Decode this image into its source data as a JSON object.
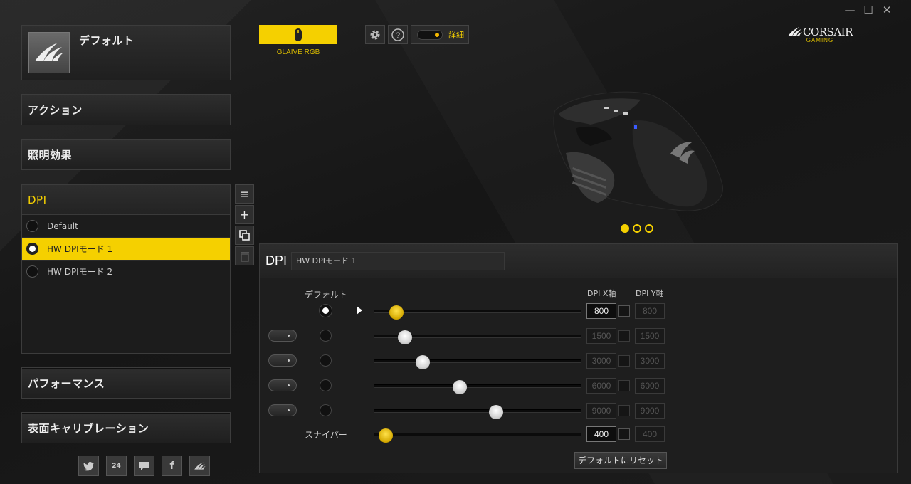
{
  "window": {
    "minimize": "—",
    "maximize": "☐",
    "close": "✕"
  },
  "sidebar": {
    "profile_name": "デフォルト",
    "sections": {
      "actions": "アクション",
      "lighting": "照明効果",
      "dpi": "DPI",
      "performance": "パフォーマンス",
      "calibration": "表面キャリブレーション"
    },
    "dpi_modes": [
      {
        "label": "Default",
        "selected": false
      },
      {
        "label": "HW DPIモード 1",
        "selected": true
      },
      {
        "label": "HW DPIモード 2",
        "selected": false
      }
    ]
  },
  "device": {
    "name": "GLAIVE RGB"
  },
  "toolbar": {
    "details_label": "詳細"
  },
  "brand": {
    "name": "CORSAIR",
    "sub": "GAMING"
  },
  "carousel": {
    "pages": 3,
    "active": 0
  },
  "dpi_panel": {
    "title": "DPI",
    "mode_name": "HW DPIモード 1",
    "default_label": "デフォルト",
    "col_x": "DPI X軸",
    "col_y": "DPI Y軸",
    "sniper_label": "スナイパー",
    "reset_label": "デフォルトにリセット",
    "slider_max": 16000,
    "stages": [
      {
        "x": "800",
        "y": "800",
        "enabled": true,
        "default": true
      },
      {
        "x": "1500",
        "y": "1500",
        "enabled": false,
        "default": false
      },
      {
        "x": "3000",
        "y": "3000",
        "enabled": false,
        "default": false
      },
      {
        "x": "6000",
        "y": "6000",
        "enabled": false,
        "default": false
      },
      {
        "x": "9000",
        "y": "9000",
        "enabled": false,
        "default": false
      }
    ],
    "sniper": {
      "x": "400",
      "y": "400"
    }
  },
  "colors": {
    "accent": "#f5d000"
  }
}
